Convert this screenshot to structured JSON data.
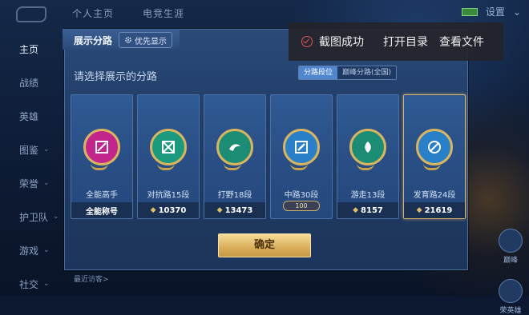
{
  "app": {
    "tabs": [
      "个人主页",
      "电竞生涯"
    ],
    "settings_label": "设置"
  },
  "sidebar": {
    "items": [
      {
        "label": "主页",
        "expandable": false,
        "active": true
      },
      {
        "label": "战绩",
        "expandable": false,
        "active": false
      },
      {
        "label": "英雄",
        "expandable": false,
        "active": false
      },
      {
        "label": "图鉴",
        "expandable": true,
        "active": false
      },
      {
        "label": "荣誉",
        "expandable": true,
        "active": false
      },
      {
        "label": "护卫队",
        "expandable": true,
        "active": false
      },
      {
        "label": "游戏",
        "expandable": true,
        "active": false
      },
      {
        "label": "社交",
        "expandable": true,
        "active": false
      }
    ]
  },
  "dialog": {
    "title": "展示分路",
    "priority_label": "优先显示",
    "subtitle": "请选择展示的分路",
    "segment": {
      "option_a": "分路段位",
      "option_b": "巅峰分路(全国)",
      "selected": "option_a"
    },
    "confirm_label": "确定",
    "cards": [
      {
        "name": "全能高手",
        "footer": "全能称号",
        "score": "",
        "color": "#c2258c",
        "icon": "allround-icon",
        "selected": false
      },
      {
        "name": "对抗路15段",
        "footer": "10370",
        "score": "10370",
        "color": "#1c9a80",
        "icon": "sword-icon",
        "selected": false
      },
      {
        "name": "打野18段",
        "footer": "13473",
        "score": "13473",
        "color": "#1c8c74",
        "icon": "dragon-icon",
        "selected": false
      },
      {
        "name": "中路30段",
        "footer": "",
        "score": "",
        "rank_badge": "100",
        "color": "#2a7fc9",
        "icon": "wand-icon",
        "selected": false
      },
      {
        "name": "游走13段",
        "footer": "8157",
        "score": "8157",
        "color": "#1c8c74",
        "icon": "shield-leaf-icon",
        "selected": false
      },
      {
        "name": "发育路24段",
        "footer": "21619",
        "score": "21619",
        "color": "#2a7fc9",
        "icon": "target-icon",
        "selected": true
      }
    ]
  },
  "toast": {
    "message": "截图成功",
    "open_folder": "打开目录",
    "view_file": "查看文件"
  },
  "bottom": {
    "left_text": "最近访客>",
    "right_labels": [
      "巅峰",
      "荣英雄"
    ]
  }
}
